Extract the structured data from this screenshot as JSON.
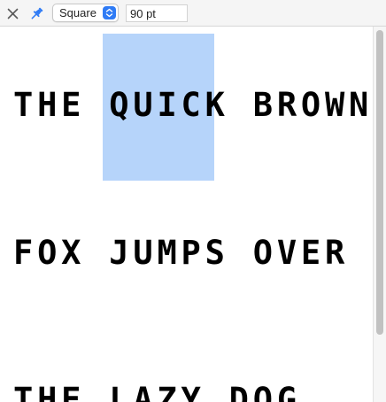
{
  "toolbar": {
    "close_icon": "close-icon",
    "pin_icon": "pin-icon",
    "style_select": {
      "value": "Square",
      "stepper_icon": "up-down-chevron-icon"
    },
    "size_field": {
      "value": "90 pt"
    }
  },
  "preview": {
    "lines": [
      "THE QUICK BROWN",
      "FOX JUMPS OVER",
      "THE LAZY DOG"
    ],
    "selected_text": "QUICK"
  },
  "colors": {
    "selection": "#b6d4fa",
    "accent": "#2f7bf5",
    "text": "#000000"
  }
}
